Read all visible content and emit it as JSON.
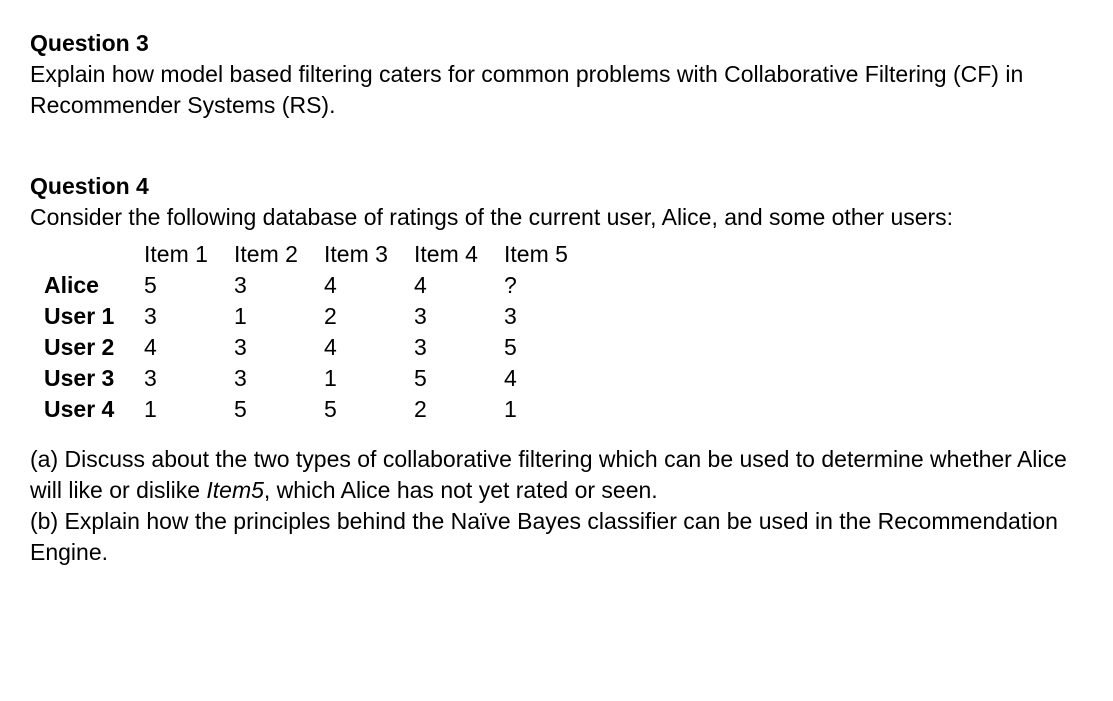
{
  "q3": {
    "heading": "Question 3",
    "body": "Explain how model based filtering caters for common problems with Collaborative Filtering (CF) in Recommender Systems (RS)."
  },
  "q4": {
    "heading": "Question 4",
    "intro": "Consider the following database of ratings of the current user, Alice, and some other users:",
    "table": {
      "headers": [
        "",
        "Item 1",
        "Item 2",
        "Item 3",
        "Item 4",
        "Item 5"
      ],
      "rows": [
        {
          "label": "Alice",
          "cells": [
            "5",
            "3",
            "4",
            "4",
            "?"
          ]
        },
        {
          "label": "User 1",
          "cells": [
            "3",
            "1",
            "2",
            "3",
            "3"
          ]
        },
        {
          "label": "User 2",
          "cells": [
            "4",
            "3",
            "4",
            "3",
            "5"
          ]
        },
        {
          "label": "User 3",
          "cells": [
            "3",
            "3",
            "1",
            "5",
            "4"
          ]
        },
        {
          "label": "User 4",
          "cells": [
            "1",
            "5",
            "5",
            "2",
            "1"
          ]
        }
      ]
    },
    "part_a_prefix": "(a) Discuss about the two types of collaborative filtering which can be used to determine whether Alice will like or dislike ",
    "part_a_italic": "Item5",
    "part_a_suffix": ", which Alice has not yet rated or seen.",
    "part_b": "(b) Explain how the principles behind the Naïve Bayes classifier can be used in the Recommendation Engine."
  }
}
